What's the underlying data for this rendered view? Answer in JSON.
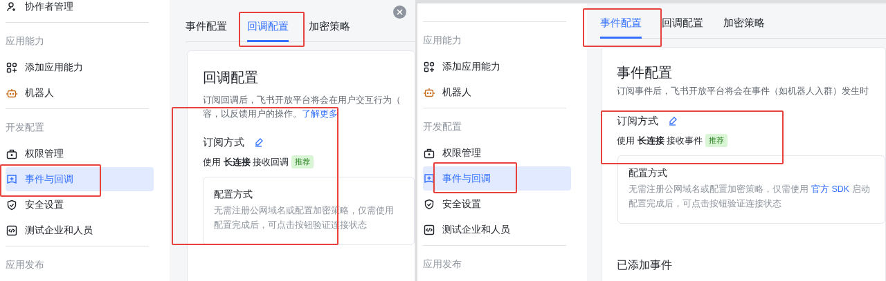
{
  "panels": [
    {
      "closable": true,
      "sidebar": {
        "sections": [
          {
            "items": [
              {
                "kind": "collaborators",
                "label": "协作者管理",
                "selected": false
              }
            ]
          },
          {
            "title": "应用能力",
            "items": [
              {
                "kind": "capabilities",
                "label": "添加应用能力",
                "selected": false
              },
              {
                "kind": "bot",
                "label": "机器人",
                "selected": false
              }
            ]
          },
          {
            "title": "开发配置",
            "items": [
              {
                "kind": "permissions",
                "label": "权限管理",
                "selected": false
              },
              {
                "kind": "events",
                "label": "事件与回调",
                "selected": true
              },
              {
                "kind": "security",
                "label": "安全设置",
                "selected": false
              },
              {
                "kind": "testing",
                "label": "测试企业和人员",
                "selected": false
              }
            ]
          },
          {
            "title": "应用发布"
          }
        ]
      },
      "tabs": [
        {
          "label": "事件配置",
          "selected": false
        },
        {
          "label": "回调配置",
          "selected": true
        },
        {
          "label": "加密策略",
          "selected": false
        }
      ],
      "card": {
        "title": "回调配置",
        "description": [
          {
            "text": "订阅回调后，飞书开放平台将会在用户交互行为（"
          },
          {
            "text": "容，以反馈用户的操作。",
            "link": "了解更多"
          }
        ],
        "subscription": {
          "label": "订阅方式",
          "value": "使用 **长连接** 接收回调",
          "badge": "推荐"
        },
        "config": {
          "title": "配置方式",
          "lines": [
            {
              "text": "无需注册公网域名或配置加密策略，仅需使用"
            },
            {
              "text": "配置完成后，可点击按钮验证连接状态"
            }
          ]
        }
      }
    },
    {
      "sidebar": {
        "sections": [
          {
            "title": "应用能力",
            "items": [
              {
                "kind": "capabilities",
                "label": "添加应用能力",
                "selected": false
              },
              {
                "kind": "bot",
                "label": "机器人",
                "selected": false
              }
            ]
          },
          {
            "title": "开发配置",
            "items": [
              {
                "kind": "permissions",
                "label": "权限管理",
                "selected": false
              },
              {
                "kind": "events",
                "label": "事件与回调",
                "selected": true
              },
              {
                "kind": "security",
                "label": "安全设置",
                "selected": false
              },
              {
                "kind": "testing",
                "label": "测试企业和人员",
                "selected": false
              }
            ]
          },
          {
            "title": "应用发布"
          }
        ]
      },
      "tabs": [
        {
          "label": "事件配置",
          "selected": true
        },
        {
          "label": "回调配置",
          "selected": false
        },
        {
          "label": "加密策略",
          "selected": false
        }
      ],
      "card": {
        "title": "事件配置",
        "description": [
          {
            "text": "订阅事件后，飞书开放平台将会在事件（如机器人入群）发生时"
          }
        ],
        "subscription": {
          "label": "订阅方式",
          "value": "使用 **长连接** 接收事件",
          "badge": "推荐"
        },
        "config": {
          "title": "配置方式",
          "lines": [
            {
              "text": "无需注册公网域名或配置加密策略，仅需使用",
              "link": "官方 SDK",
              "after": "启动"
            },
            {
              "text": "配置完成后，可点击按钮验证连接状态"
            }
          ]
        },
        "section_heading": "已添加事件"
      }
    }
  ]
}
